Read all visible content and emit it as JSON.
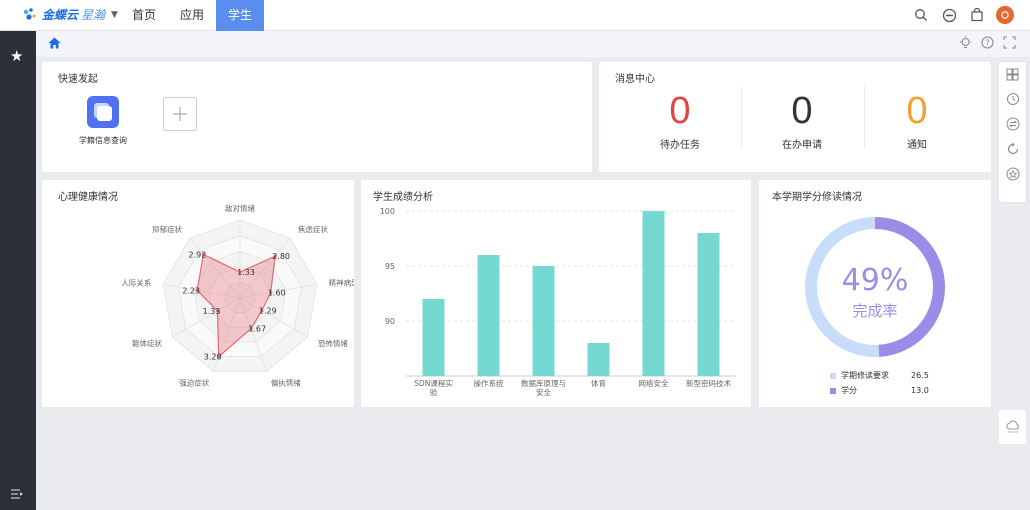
{
  "header": {
    "logo_text": "金蝶云",
    "logo_sub": "星瀚",
    "nav": [
      "首页",
      "应用",
      "学生"
    ],
    "active_nav": 2
  },
  "quick_start": {
    "title": "快速发起",
    "items": [
      {
        "label": "学籍信息查询",
        "icon": "app-icon"
      }
    ]
  },
  "message_center": {
    "title": "消息中心",
    "items": [
      {
        "count": "0",
        "label": "待办任务",
        "color": "#e2453c"
      },
      {
        "count": "0",
        "label": "在办申请",
        "color": "#333333"
      },
      {
        "count": "0",
        "label": "通知",
        "color": "#f0a12f"
      }
    ]
  },
  "psych": {
    "title": "心理健康情况",
    "radar": {
      "axes": [
        "敌对情绪",
        "焦虑症状",
        "精神病型",
        "恐怖情绪",
        "偏执情绪",
        "强迫症状",
        "躯体症状",
        "人际关系",
        "抑郁症状"
      ],
      "values": [
        1.33,
        2.8,
        1.6,
        1.29,
        1.67,
        3.2,
        1.33,
        2.23,
        2.92
      ]
    }
  },
  "scores": {
    "title": "学生成绩分析",
    "chart_data": {
      "type": "bar",
      "categories": [
        "SDN课程实验",
        "操作系统",
        "数据库原理与安全",
        "体育",
        "网络安全",
        "新型密码技术"
      ],
      "values": [
        92,
        96,
        95,
        88,
        100,
        98
      ],
      "ylim": [
        85,
        100
      ],
      "yticks": [
        90,
        95,
        100
      ],
      "color": "#76d9d1"
    }
  },
  "credits": {
    "title": "本学期学分修读情况",
    "percent": "49%",
    "percent_label": "完成率",
    "fraction": 0.49,
    "legend": [
      {
        "name": "学期修读要求",
        "value": "26.5",
        "color": "#c9ddfa"
      },
      {
        "name": "学分",
        "value": "13.0",
        "color": "#9b8ce8"
      }
    ]
  }
}
